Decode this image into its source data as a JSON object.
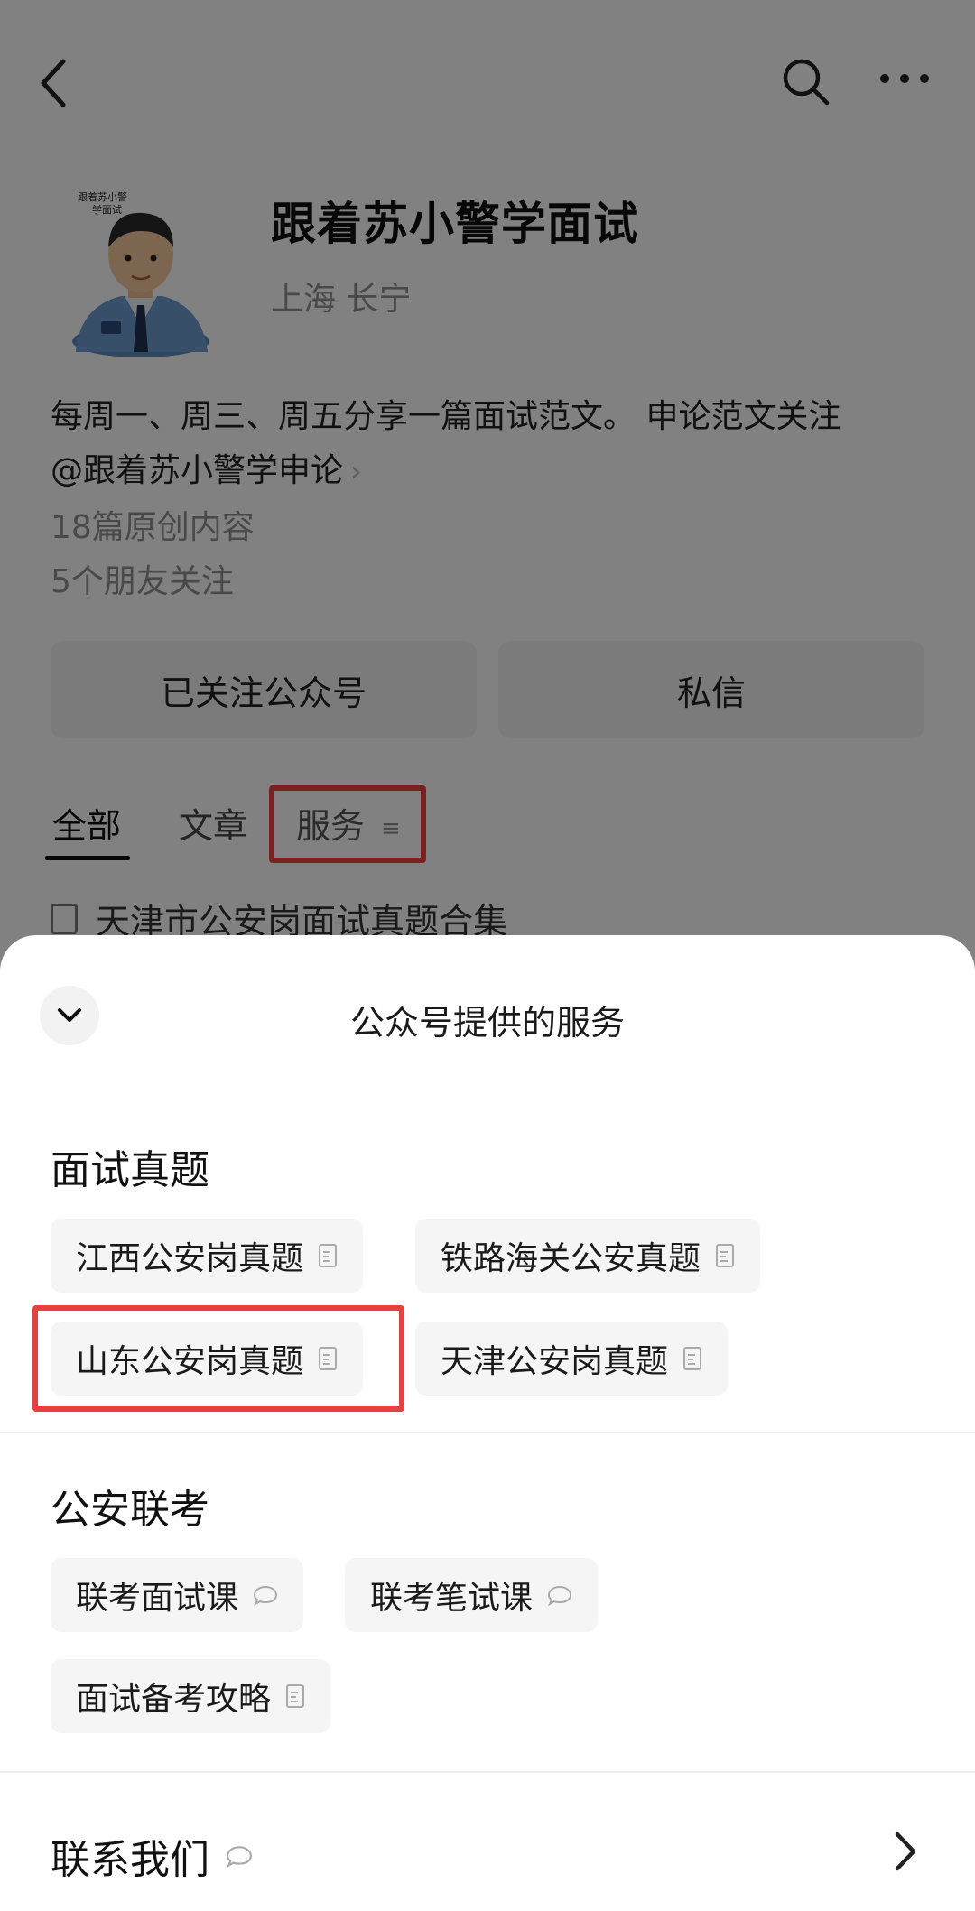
{
  "profile": {
    "account_name": "跟着苏小警学面试",
    "location": "上海 长宁",
    "description_line1": "每周一、周三、周五分享一篇面试范文。 申论范文关注",
    "description_line2": "@跟着苏小警学申论",
    "original_count": "18篇原创内容",
    "friends_following": "5个朋友关注",
    "follow_button": "已关注公众号",
    "message_button": "私信",
    "avatar_caption": "跟着苏小警学面试"
  },
  "tabs": [
    {
      "label": "全部",
      "active": true
    },
    {
      "label": "文章",
      "active": false
    },
    {
      "label": "服务",
      "active": false
    }
  ],
  "first_article": "天津市公安岗面试真题合集",
  "sheet": {
    "title": "公众号提供的服务",
    "sections": [
      {
        "title": "面试真题",
        "items": [
          {
            "label": "江西公安岗真题",
            "icon": "doc-icon"
          },
          {
            "label": "铁路海关公安真题",
            "icon": "doc-icon"
          },
          {
            "label": "山东公安岗真题",
            "icon": "doc-icon",
            "highlighted": true
          },
          {
            "label": "天津公安岗真题",
            "icon": "doc-icon"
          }
        ]
      },
      {
        "title": "公安联考",
        "items": [
          {
            "label": "联考面试课",
            "icon": "chat-icon"
          },
          {
            "label": "联考笔试课",
            "icon": "chat-icon"
          },
          {
            "label": "面试备考攻略",
            "icon": "doc-icon"
          }
        ]
      }
    ],
    "contact_label": "联系我们"
  },
  "colors": {
    "highlight": "#e8403e",
    "overlay": "rgba(0,0,0,0.48)"
  }
}
